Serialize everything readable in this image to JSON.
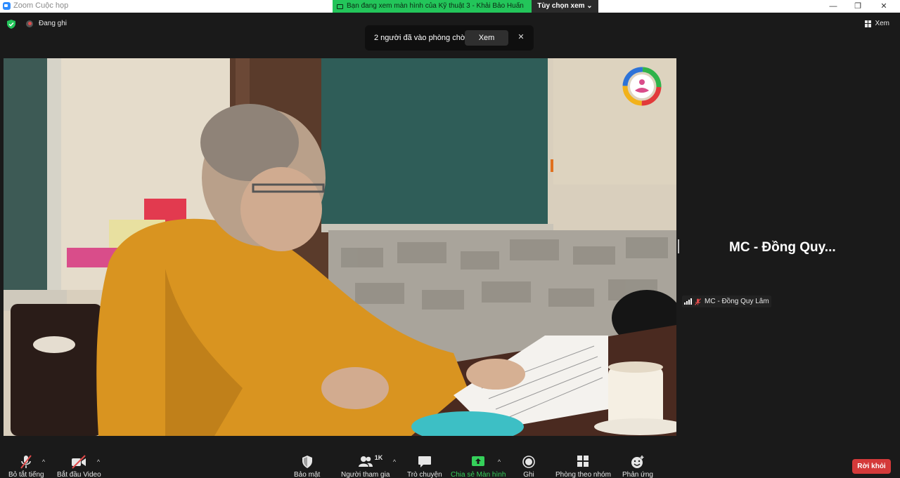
{
  "window": {
    "title": "Zoom Cuộc họp",
    "minimize": "—",
    "restore": "❐",
    "close": "✕"
  },
  "share_banner": {
    "text": "Bạn đang xem màn hình của Kỹ thuật 3 - Khải Bảo Huấn",
    "view_options": "Tùy chọn xem ⌄"
  },
  "status": {
    "recording": "Đang ghi",
    "view": "Xem"
  },
  "toast": {
    "text": "2 người đã vào phòng chờ",
    "view_button": "Xem",
    "close": "✕"
  },
  "participant": {
    "tile_name": "MC - Đồng Quy...",
    "label": "MC - Đồng Quy Lâm"
  },
  "toolbar": {
    "mute": "Bỏ tắt tiếng",
    "start_video": "Bắt đầu Video",
    "security": "Bảo mật",
    "participants": "Người tham gia",
    "participants_count": "1K",
    "chat": "Trò chuyện",
    "share_screen": "Chia sẻ Màn hình",
    "record": "Ghi",
    "breakout": "Phòng theo nhóm",
    "reactions": "Phản ứng",
    "leave": "Rời khỏi",
    "caret": "^"
  },
  "colors": {
    "share_green": "#23c55a",
    "leave_red": "#d43a3a",
    "accent_blue": "#2d8cff"
  }
}
